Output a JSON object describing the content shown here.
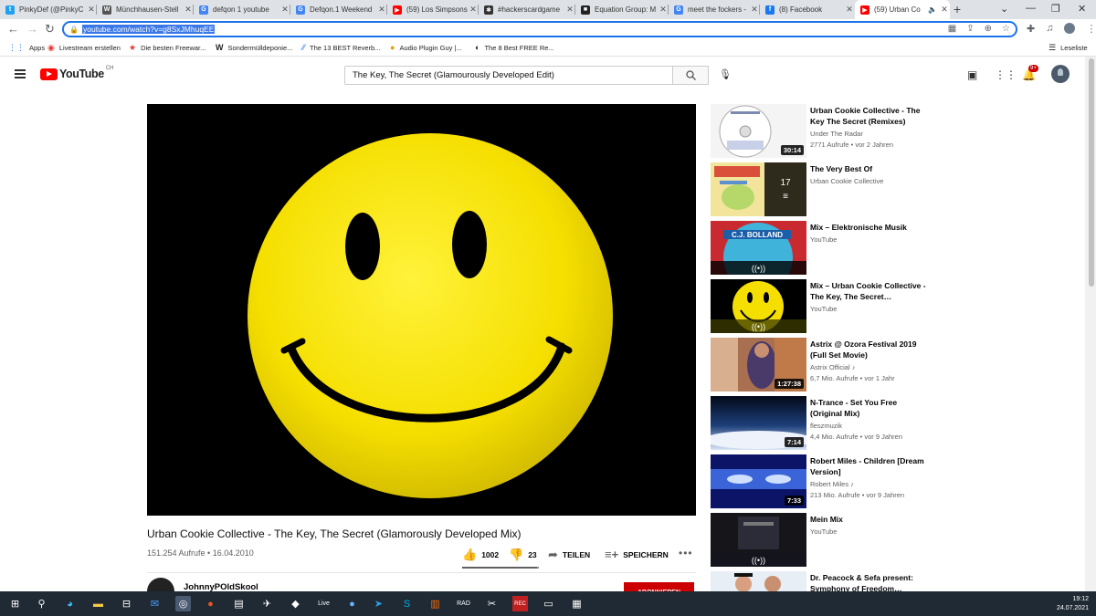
{
  "browser": {
    "tabs": [
      {
        "title": "PinkyDef (@PinkyC",
        "fav_color": "#1da1f2",
        "fav_glyph": "t"
      },
      {
        "title": "Münchhausen-Stell",
        "fav_color": "#555555",
        "fav_glyph": "W"
      },
      {
        "title": "defqon 1 youtube",
        "fav_color": "#4285f4",
        "fav_glyph": "G"
      },
      {
        "title": "Defqon.1 Weekend",
        "fav_color": "#4285f4",
        "fav_glyph": "G"
      },
      {
        "title": "(59) Los Simpsons",
        "fav_color": "#ff0000",
        "fav_glyph": "▶"
      },
      {
        "title": "#hackerscardgame",
        "fav_color": "#333333",
        "fav_glyph": "✱"
      },
      {
        "title": "Equation Group: M",
        "fav_color": "#222222",
        "fav_glyph": "■"
      },
      {
        "title": "meet the fockers -",
        "fav_color": "#4285f4",
        "fav_glyph": "G"
      },
      {
        "title": "(8) Facebook",
        "fav_color": "#1877f2",
        "fav_glyph": "f"
      },
      {
        "title": "(59) Urban Co",
        "fav_color": "#ff0000",
        "fav_glyph": "▶"
      }
    ],
    "url": "youtube.com/watch?v=g8SxJMhuqEE",
    "bookmarks": [
      {
        "label": "Apps",
        "icon": "apps-grid-icon"
      },
      {
        "label": "Livestream erstellen",
        "icon": "livestream-icon"
      },
      {
        "label": "Die besten Freewar...",
        "icon": "star-icon"
      },
      {
        "label": "Sondermülldeponie...",
        "icon": "w-icon"
      },
      {
        "label": "The 13 BEST Reverb...",
        "icon": "reverb-icon"
      },
      {
        "label": "Audio Plugin Guy |...",
        "icon": "plugin-icon"
      },
      {
        "label": "The 8 Best FREE Re...",
        "icon": "moon-icon"
      }
    ],
    "reading_list": "Leseliste"
  },
  "youtube": {
    "logo_word": "YouTube",
    "logo_country": "CH",
    "search_query": "The Key, The Secret (Glamourously Developed Edit)",
    "notif_count": "9+",
    "video": {
      "title": "Urban Cookie Collective - The Key, The Secret (Glamorously Developed Mix)",
      "views_date": "151.254 Aufrufe • 16.04.2010",
      "likes": "1002",
      "dislikes": "23",
      "share": "TEILEN",
      "save": "SPEICHERN",
      "channel": "JohnnyPOldSkool",
      "subscribe": "ABONNIEREN"
    },
    "recommendations": [
      {
        "title": "Urban Cookie Collective - The Key The Secret (Remixes)",
        "channel": "Under The Radar",
        "meta": "2771 Aufrufe • vor 2 Jahren",
        "duration": "30:14",
        "kind": "video"
      },
      {
        "title": "The Very Best Of",
        "channel": "Urban Cookie Collective",
        "meta": "",
        "duration": "17",
        "kind": "playlist"
      },
      {
        "title": "Mix – Elektronische Musik",
        "channel": "YouTube",
        "meta": "",
        "duration": "",
        "kind": "mix"
      },
      {
        "title": "Mix – Urban Cookie Collective - The Key, The Secret…",
        "channel": "YouTube",
        "meta": "",
        "duration": "",
        "kind": "mix"
      },
      {
        "title": "Astrix @ Ozora Festival 2019 (Full Set Movie)",
        "channel": "Astrix Official ♪",
        "meta": "6,7 Mio. Aufrufe • vor 1 Jahr",
        "duration": "1:27:38",
        "kind": "video"
      },
      {
        "title": "N-Trance - Set You Free (Original Mix)",
        "channel": "fleszmuzik",
        "meta": "4,4 Mio. Aufrufe • vor 9 Jahren",
        "duration": "7:14",
        "kind": "video"
      },
      {
        "title": "Robert Miles - Children [Dream Version]",
        "channel": "Robert Miles ♪",
        "meta": "213 Mio. Aufrufe • vor 9 Jahren",
        "duration": "7:33",
        "kind": "video"
      },
      {
        "title": "Mein Mix",
        "channel": "YouTube",
        "meta": "",
        "duration": "",
        "kind": "mix"
      },
      {
        "title": "Dr. Peacock & Sefa present: Symphony of Freedom…",
        "channel": "",
        "meta": "",
        "duration": "",
        "kind": "video"
      }
    ],
    "thumb_texts": {
      "cj_bolland": "C.J. BOLLAND"
    }
  },
  "taskbar": {
    "time": "19:12",
    "date": "24.07.2021"
  },
  "colors": {
    "accent_blue": "#1a73e8",
    "youtube_red": "#ff0000",
    "subscribe_red": "#cc0000",
    "smiley_yellow": "#f7e400"
  }
}
